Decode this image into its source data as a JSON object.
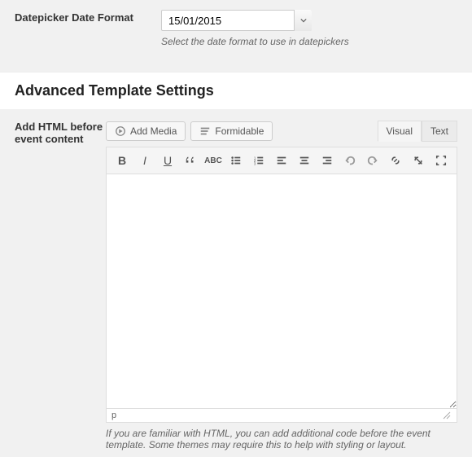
{
  "datepicker": {
    "label": "Datepicker Date Format",
    "value": "15/01/2015",
    "description": "Select the date format to use in datepickers"
  },
  "section_title": "Advanced Template Settings",
  "field": {
    "label": "Add HTML before event content",
    "add_media": "Add Media",
    "formidable": "Formidable",
    "tab_visual": "Visual",
    "tab_text": "Text",
    "status_path": "p",
    "description": "If you are familiar with HTML, you can add additional code before the event template. Some themes may require this to help with styling or layout."
  }
}
